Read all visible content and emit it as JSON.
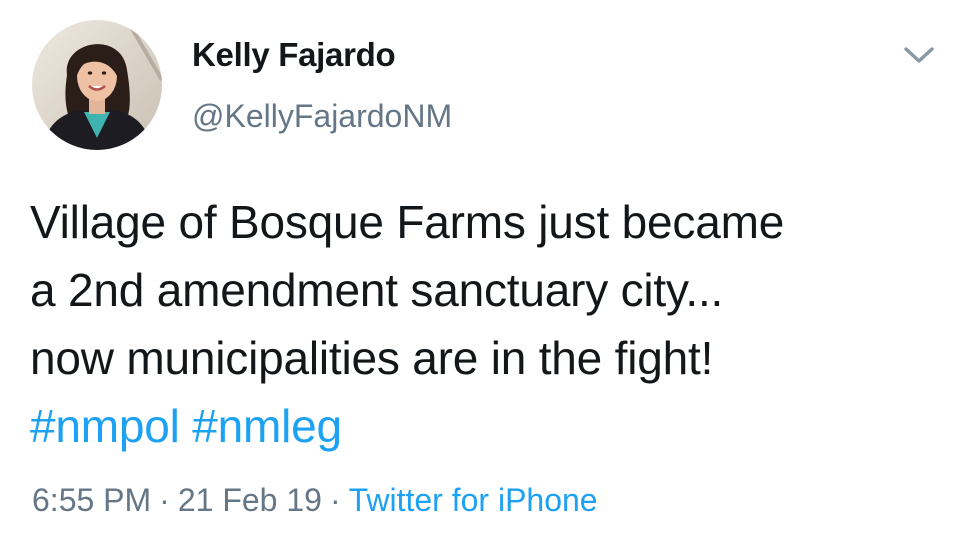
{
  "author": {
    "display_name": "Kelly Fajardo",
    "handle": "@KellyFajardoNM"
  },
  "tweet": {
    "lines": [
      "Village of Bosque Farms just became",
      "a 2nd amendment sanctuary city...",
      "now municipalities are in the fight!"
    ],
    "hashtags": [
      "#nmpol",
      "#nmleg"
    ]
  },
  "meta": {
    "time": "6:55 PM",
    "date": "21 Feb 19",
    "source": "Twitter for iPhone",
    "separator": "·"
  },
  "icons": {
    "menu": "chevron-down-icon",
    "avatar": "profile-photo"
  },
  "colors": {
    "text": "#14171a",
    "secondary": "#657786",
    "link": "#1da1f2"
  }
}
